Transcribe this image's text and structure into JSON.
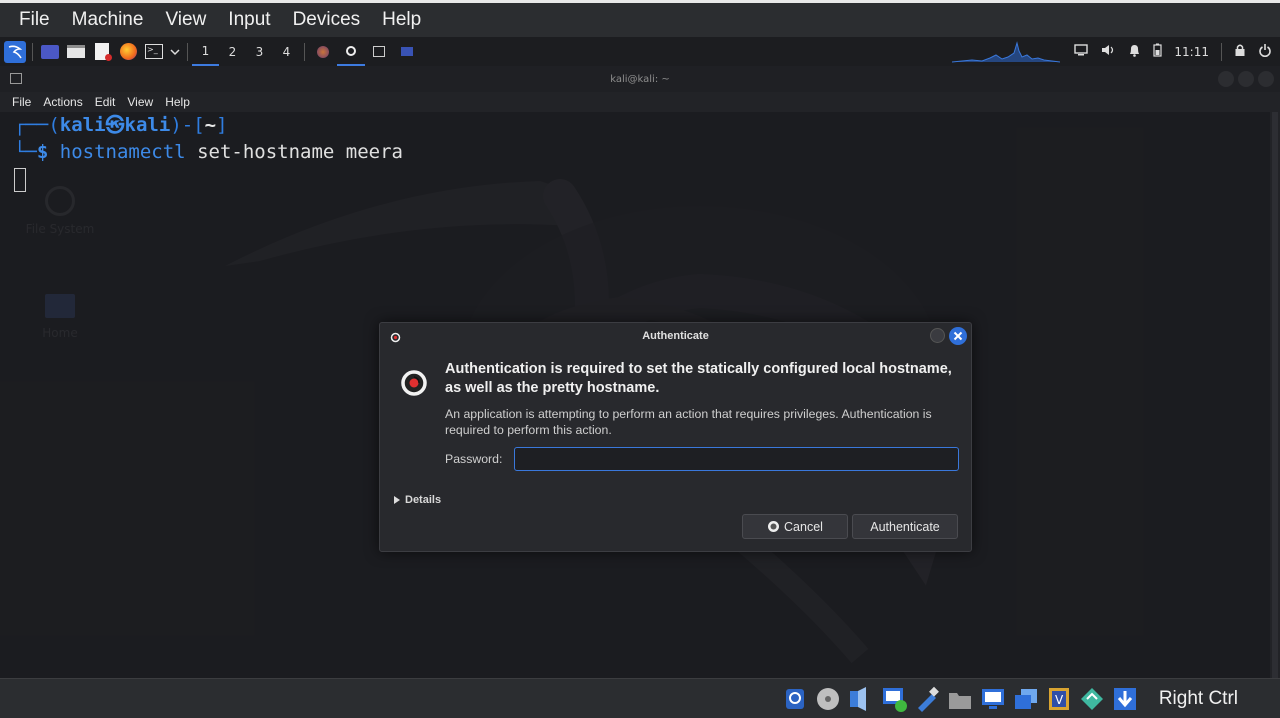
{
  "vbox_menu": [
    "File",
    "Machine",
    "View",
    "Input",
    "Devices",
    "Help"
  ],
  "panel": {
    "workspaces": [
      "1",
      "2",
      "3",
      "4"
    ],
    "active_workspace": "1",
    "clock": "11:11"
  },
  "terminal": {
    "title": "kali@kali: ~",
    "menu": [
      "File",
      "Actions",
      "Edit",
      "View",
      "Help"
    ],
    "prompt_user": "kali",
    "prompt_sep": "㉿",
    "prompt_host": "kali",
    "prompt_path": "~",
    "command_name": "hostnamectl",
    "command_args": "set-hostname meera"
  },
  "desktop": {
    "icons": [
      "File System",
      "Home"
    ]
  },
  "dialog": {
    "title": "Authenticate",
    "heading": "Authentication is required to set the statically configured local hostname, as well as the pretty hostname.",
    "body": "An application is attempting to perform an action that requires privileges. Authentication is required to perform this action.",
    "password_label": "Password:",
    "password_value": "",
    "details_label": "Details",
    "cancel_label": "Cancel",
    "authenticate_label": "Authenticate"
  },
  "status": {
    "host_key": "Right Ctrl"
  },
  "colors": {
    "accent": "#3d7be0",
    "prompt_blue": "#2f7de0"
  }
}
